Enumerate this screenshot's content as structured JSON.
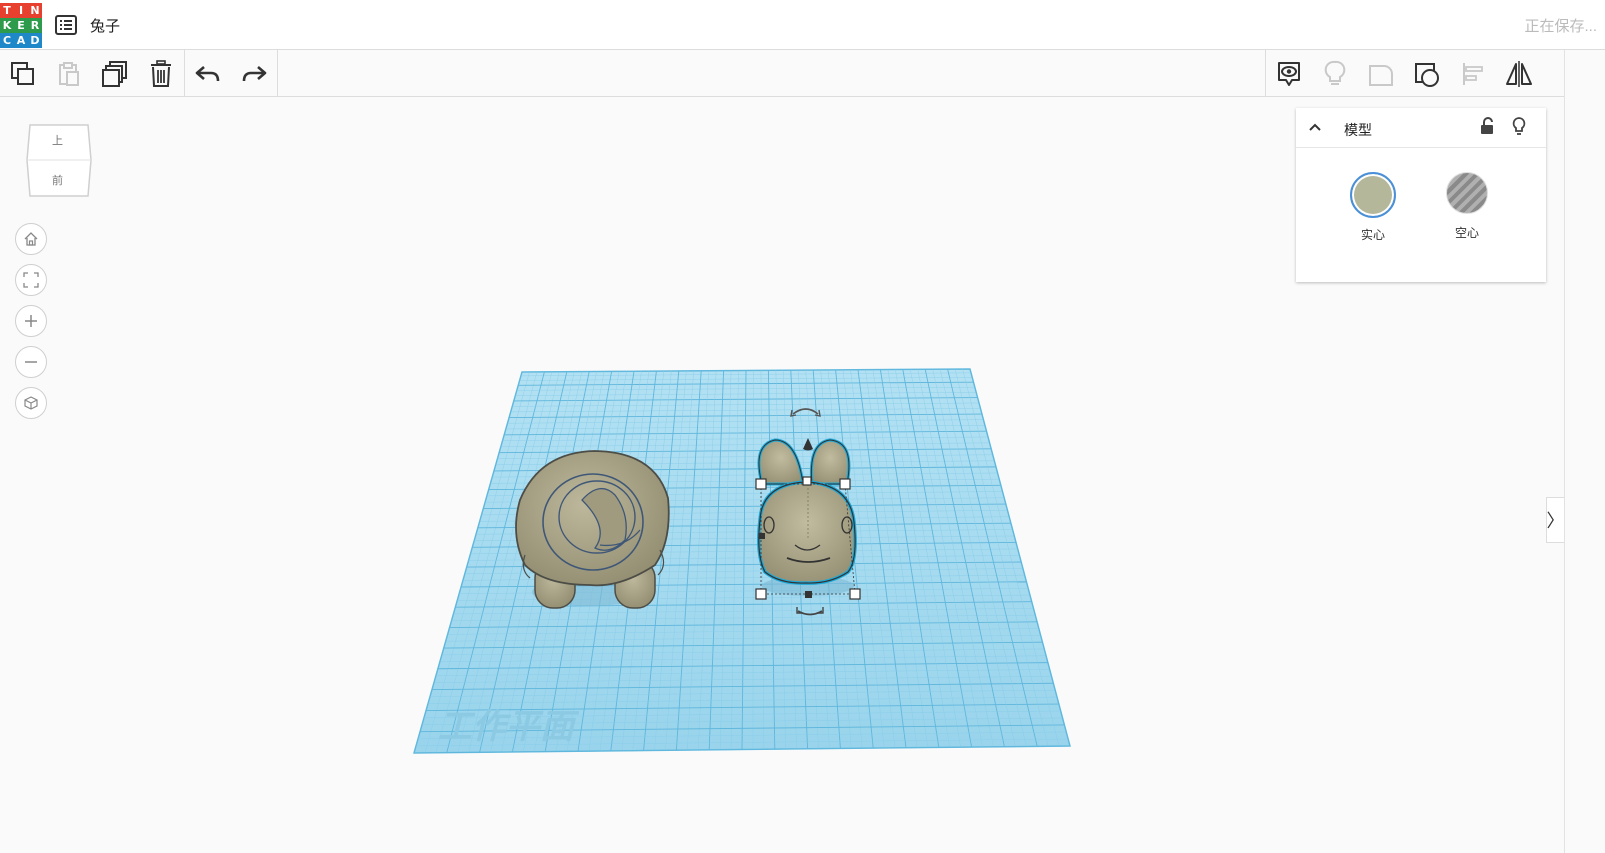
{
  "header": {
    "logo_letters": [
      "T",
      "I",
      "N",
      "K",
      "E",
      "R",
      "C",
      "A",
      "D"
    ],
    "logo_colors": [
      "#e8402f",
      "#e8402f",
      "#e8402f",
      "#2e9b4c",
      "#2e9b4c",
      "#2e9b4c",
      "#1e88c9",
      "#1e88c9",
      "#1e88c9"
    ],
    "list_icon": "list-icon",
    "title": "兔子",
    "status": "正在保存..."
  },
  "toolbar": {
    "left_icons": [
      "copy-icon",
      "paste-icon",
      "duplicate-icon",
      "delete-icon",
      "undo-icon",
      "redo-icon"
    ],
    "right_icons": [
      "notes-icon",
      "light-icon",
      "group-icon",
      "ungroup-icon",
      "align-icon",
      "mirror-icon"
    ]
  },
  "viewcube": {
    "top": "上",
    "front": "前"
  },
  "nav": [
    "home-icon",
    "fit-icon",
    "zoom-in-icon",
    "zoom-out-icon",
    "perspective-icon"
  ],
  "workplane": {
    "label": "工作平面",
    "grid_color": "#9bd6ee",
    "line_color": "#6ec1e4"
  },
  "inspector": {
    "title": "模型",
    "solid_label": "实心",
    "hole_label": "空心",
    "solid_color": "#b5b79a"
  },
  "colors": {
    "model": "#aea98c",
    "model_outline": "#5e5e58",
    "selection": "#1ba8d8"
  }
}
